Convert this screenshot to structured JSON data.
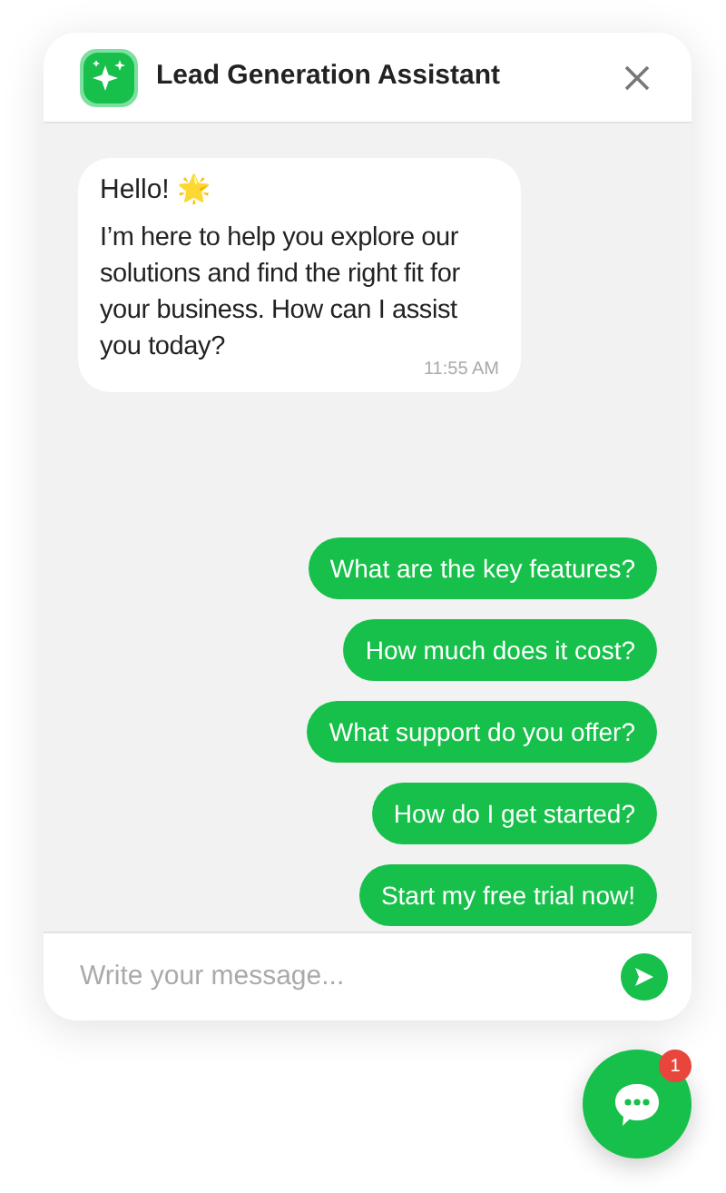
{
  "header": {
    "title": "Lead Generation Assistant"
  },
  "messages": [
    {
      "greeting": "Hello! 🌟",
      "text": "I’m here to help you explore our solutions and find the right fit for your business. How can I assist you today?",
      "time": "11:55 AM"
    }
  ],
  "quick_replies": [
    "What are the key features?",
    "How much does it cost?",
    "What support do you offer?",
    "How do I get started?",
    "Start my free trial now!"
  ],
  "composer": {
    "placeholder": "Write your message..."
  },
  "launcher": {
    "badge": "1"
  }
}
